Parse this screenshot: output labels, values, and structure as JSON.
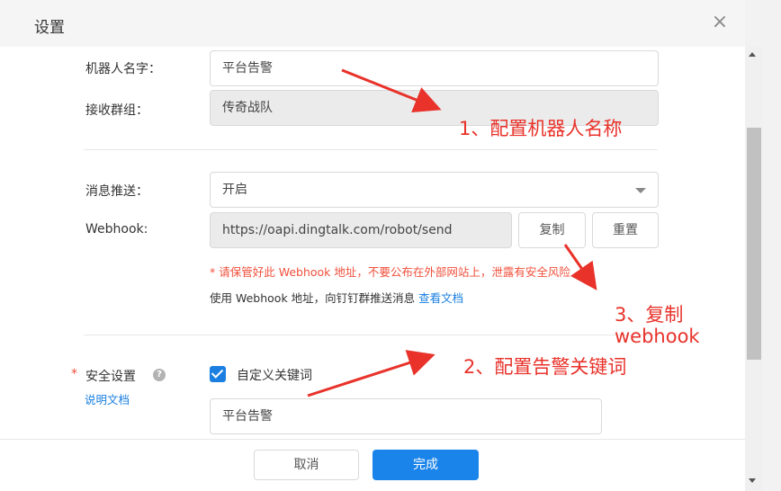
{
  "dialog": {
    "title": "设置",
    "close_glyph": "×"
  },
  "form": {
    "robot_name": {
      "label": "机器人名字：",
      "value": "平台告警"
    },
    "group": {
      "label": "接收群组：",
      "value": "传奇战队"
    },
    "push": {
      "label": "消息推送：",
      "value": "开启"
    },
    "webhook": {
      "label": "Webhook:",
      "value": "https://oapi.dingtalk.com/robot/send",
      "copy_label": "复制",
      "reset_label": "重置",
      "warning": "* 请保管好此 Webhook 地址，不要公布在外部网站上，泄露有安全风险",
      "info": "使用 Webhook 地址，向钉钉群推送消息",
      "doc_link": "查看文档"
    },
    "security": {
      "required_mark": "*",
      "label": "安全设置",
      "help_glyph": "?",
      "doc_link": "说明文档",
      "option_label": "自定义关键词",
      "option_checked": true,
      "keyword_value": "平台告警"
    }
  },
  "footer": {
    "cancel_label": "取消",
    "ok_label": "完成",
    "ok_color": "#1a84ea"
  },
  "annotations": {
    "step1": "1、配置机器人名称",
    "step2": "2、配置告警关键词",
    "step3_line1": "3、复制",
    "step3_line2": "webhook",
    "color": "#e8322a"
  }
}
